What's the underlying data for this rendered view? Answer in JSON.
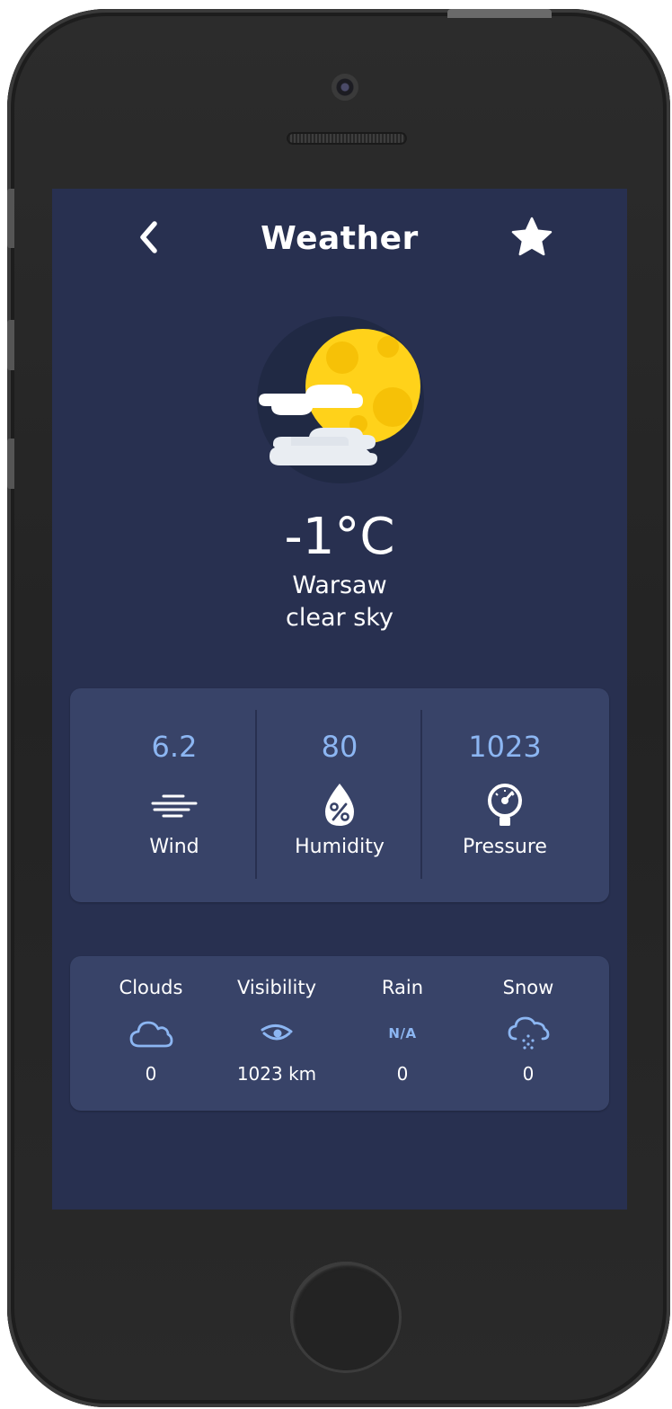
{
  "header": {
    "title": "Weather",
    "back_icon": "chevron-left-icon",
    "favorite_icon": "star-icon"
  },
  "current": {
    "icon": "moon-clouds-icon",
    "temperature": "-1°C",
    "city": "Warsaw",
    "description": "clear sky"
  },
  "stats": [
    {
      "value": "6.2",
      "label": "Wind",
      "icon": "wind-icon"
    },
    {
      "value": "80",
      "label": "Humidity",
      "icon": "humidity-drop-icon"
    },
    {
      "value": "1023",
      "label": "Pressure",
      "icon": "barometer-icon"
    }
  ],
  "extras": [
    {
      "label": "Clouds",
      "value": "0",
      "icon": "cloud-icon"
    },
    {
      "label": "Visibility",
      "value": "1023 km",
      "icon": "eye-icon"
    },
    {
      "label": "Rain",
      "value": "0",
      "icon": "na-icon",
      "icon_text": "N/A"
    },
    {
      "label": "Snow",
      "value": "0",
      "icon": "snow-cloud-icon"
    }
  ],
  "colors": {
    "background": "#283050",
    "card": "#384368",
    "accent": "#8cb6f2",
    "moon": "#ffd21a",
    "text": "#ffffff"
  }
}
